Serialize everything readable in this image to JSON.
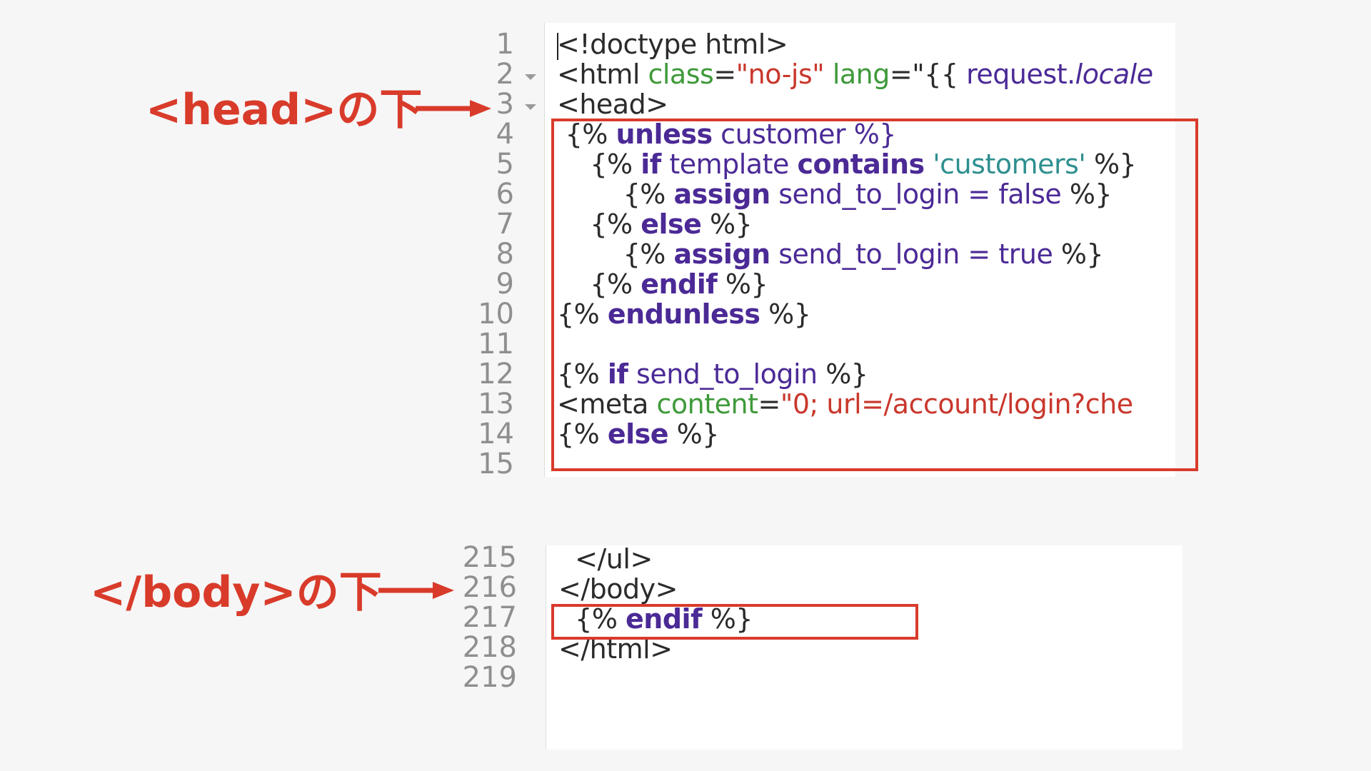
{
  "annotations": {
    "head_label": "<head>の下",
    "body_label": "</body>の下"
  },
  "colors": {
    "accent": "#d93b2b",
    "keyword": "#4b2a96",
    "attribute": "#3f9a3a",
    "string": "#c9372c",
    "single_quote_string": "#2f8f8f",
    "line_number": "#8f8f8f"
  },
  "top_editor": {
    "line_numbers": [
      "1",
      "2",
      "3",
      "4",
      "5",
      "6",
      "7",
      "8",
      "9",
      "10",
      "11",
      "12",
      "13",
      "14",
      "15"
    ],
    "lines": {
      "l1": "<!doctype html>",
      "l2_tag": "<html ",
      "l2_attr1": "class",
      "l2_eq1": "=",
      "l2_val1": "\"no-js\"",
      "l2_attr2": " lang",
      "l2_eq2": "=\"{{ ",
      "l2_var": "request.",
      "l2_ital": "locale",
      "l3": "<head>",
      "l4_open": " {% ",
      "l4_kw": "unless",
      "l4_rest": " customer %}",
      "l5_open": "    {% ",
      "l5_kw1": "if",
      "l5_var": " template ",
      "l5_kw2": "contains",
      "l5_str": " 'customers'",
      "l5_close": " %}",
      "l6_open": "        {% ",
      "l6_kw": "assign",
      "l6_rest": " send_to_login = false",
      "l6_close": " %}",
      "l7_open": "    {% ",
      "l7_kw": "else",
      "l7_close": " %}",
      "l8_open": "        {% ",
      "l8_kw": "assign",
      "l8_rest": " send_to_login = true",
      "l8_close": " %}",
      "l9_open": "    {% ",
      "l9_kw": "endif",
      "l9_close": " %}",
      "l10_open": "{% ",
      "l10_kw": "endunless",
      "l10_close": " %}",
      "l12_open": "{% ",
      "l12_kw": "if",
      "l12_var": " send_to_login",
      "l12_close": " %}",
      "l13_tag": "<meta ",
      "l13_attr": "content",
      "l13_eq": "=",
      "l13_val": "\"0; url=/account/login?che",
      "l14_open": "{% ",
      "l14_kw": "else",
      "l14_close": " %}"
    },
    "fold_lines": [
      "2",
      "3"
    ]
  },
  "bottom_editor": {
    "line_numbers": [
      "215",
      "216",
      "217",
      "218",
      "219"
    ],
    "lines": {
      "l215": "  </ul>",
      "l216": "</body>",
      "l217_open": "  {% ",
      "l217_kw": "endif",
      "l217_close": " %}",
      "l218": "</html>"
    }
  }
}
